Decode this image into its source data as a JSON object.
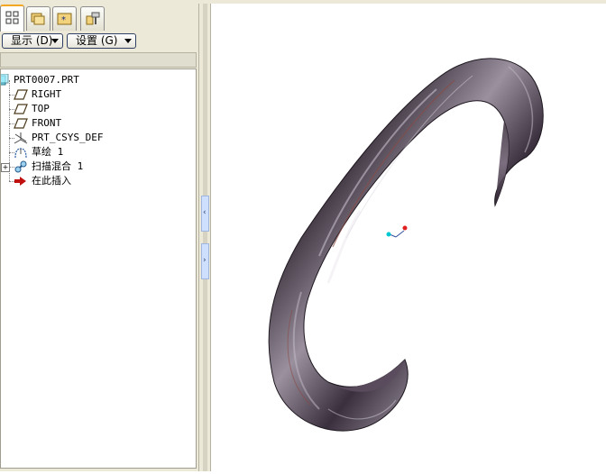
{
  "tabs": [
    {
      "icon": "model-tree-icon",
      "active": true
    },
    {
      "icon": "folder-browser-icon",
      "active": false
    },
    {
      "icon": "favorites-icon",
      "active": false
    },
    {
      "icon": "connections-icon",
      "active": false
    }
  ],
  "toolbar": {
    "show_label": "显示 (D)",
    "settings_label": "设置 (G)"
  },
  "tree": {
    "items": [
      {
        "label": "PRT0007.PRT",
        "icon": "part-icon"
      },
      {
        "label": "RIGHT",
        "icon": "datum-plane-icon"
      },
      {
        "label": "TOP",
        "icon": "datum-plane-icon"
      },
      {
        "label": "FRONT",
        "icon": "datum-plane-icon"
      },
      {
        "label": "PRT_CSYS_DEF",
        "icon": "coordinate-system-icon"
      },
      {
        "label": "草绘 1",
        "icon": "sketch-icon"
      },
      {
        "label": "扫描混合 1",
        "icon": "swept-blend-icon"
      },
      {
        "label": "在此插入",
        "icon": "insert-here-arrow-icon"
      }
    ]
  },
  "colors": {
    "panel_bg": "#ece9d8",
    "model_dark": "#2e2530",
    "model_light": "#b7b0bb",
    "model_rust": "#8a4a44",
    "csys_x": "#00c8d0",
    "csys_y": "#e02020"
  }
}
